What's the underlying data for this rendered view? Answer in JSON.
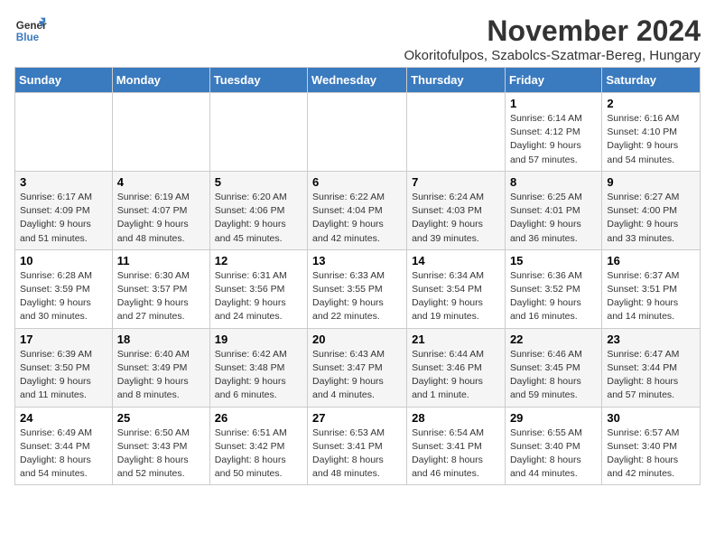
{
  "logo": {
    "line1": "General",
    "line2": "Blue"
  },
  "title": "November 2024",
  "location": "Okoritofulpos, Szabolcs-Szatmar-Bereg, Hungary",
  "days_of_week": [
    "Sunday",
    "Monday",
    "Tuesday",
    "Wednesday",
    "Thursday",
    "Friday",
    "Saturday"
  ],
  "weeks": [
    [
      {
        "day": "",
        "info": ""
      },
      {
        "day": "",
        "info": ""
      },
      {
        "day": "",
        "info": ""
      },
      {
        "day": "",
        "info": ""
      },
      {
        "day": "",
        "info": ""
      },
      {
        "day": "1",
        "info": "Sunrise: 6:14 AM\nSunset: 4:12 PM\nDaylight: 9 hours\nand 57 minutes."
      },
      {
        "day": "2",
        "info": "Sunrise: 6:16 AM\nSunset: 4:10 PM\nDaylight: 9 hours\nand 54 minutes."
      }
    ],
    [
      {
        "day": "3",
        "info": "Sunrise: 6:17 AM\nSunset: 4:09 PM\nDaylight: 9 hours\nand 51 minutes."
      },
      {
        "day": "4",
        "info": "Sunrise: 6:19 AM\nSunset: 4:07 PM\nDaylight: 9 hours\nand 48 minutes."
      },
      {
        "day": "5",
        "info": "Sunrise: 6:20 AM\nSunset: 4:06 PM\nDaylight: 9 hours\nand 45 minutes."
      },
      {
        "day": "6",
        "info": "Sunrise: 6:22 AM\nSunset: 4:04 PM\nDaylight: 9 hours\nand 42 minutes."
      },
      {
        "day": "7",
        "info": "Sunrise: 6:24 AM\nSunset: 4:03 PM\nDaylight: 9 hours\nand 39 minutes."
      },
      {
        "day": "8",
        "info": "Sunrise: 6:25 AM\nSunset: 4:01 PM\nDaylight: 9 hours\nand 36 minutes."
      },
      {
        "day": "9",
        "info": "Sunrise: 6:27 AM\nSunset: 4:00 PM\nDaylight: 9 hours\nand 33 minutes."
      }
    ],
    [
      {
        "day": "10",
        "info": "Sunrise: 6:28 AM\nSunset: 3:59 PM\nDaylight: 9 hours\nand 30 minutes."
      },
      {
        "day": "11",
        "info": "Sunrise: 6:30 AM\nSunset: 3:57 PM\nDaylight: 9 hours\nand 27 minutes."
      },
      {
        "day": "12",
        "info": "Sunrise: 6:31 AM\nSunset: 3:56 PM\nDaylight: 9 hours\nand 24 minutes."
      },
      {
        "day": "13",
        "info": "Sunrise: 6:33 AM\nSunset: 3:55 PM\nDaylight: 9 hours\nand 22 minutes."
      },
      {
        "day": "14",
        "info": "Sunrise: 6:34 AM\nSunset: 3:54 PM\nDaylight: 9 hours\nand 19 minutes."
      },
      {
        "day": "15",
        "info": "Sunrise: 6:36 AM\nSunset: 3:52 PM\nDaylight: 9 hours\nand 16 minutes."
      },
      {
        "day": "16",
        "info": "Sunrise: 6:37 AM\nSunset: 3:51 PM\nDaylight: 9 hours\nand 14 minutes."
      }
    ],
    [
      {
        "day": "17",
        "info": "Sunrise: 6:39 AM\nSunset: 3:50 PM\nDaylight: 9 hours\nand 11 minutes."
      },
      {
        "day": "18",
        "info": "Sunrise: 6:40 AM\nSunset: 3:49 PM\nDaylight: 9 hours\nand 8 minutes."
      },
      {
        "day": "19",
        "info": "Sunrise: 6:42 AM\nSunset: 3:48 PM\nDaylight: 9 hours\nand 6 minutes."
      },
      {
        "day": "20",
        "info": "Sunrise: 6:43 AM\nSunset: 3:47 PM\nDaylight: 9 hours\nand 4 minutes."
      },
      {
        "day": "21",
        "info": "Sunrise: 6:44 AM\nSunset: 3:46 PM\nDaylight: 9 hours\nand 1 minute."
      },
      {
        "day": "22",
        "info": "Sunrise: 6:46 AM\nSunset: 3:45 PM\nDaylight: 8 hours\nand 59 minutes."
      },
      {
        "day": "23",
        "info": "Sunrise: 6:47 AM\nSunset: 3:44 PM\nDaylight: 8 hours\nand 57 minutes."
      }
    ],
    [
      {
        "day": "24",
        "info": "Sunrise: 6:49 AM\nSunset: 3:44 PM\nDaylight: 8 hours\nand 54 minutes."
      },
      {
        "day": "25",
        "info": "Sunrise: 6:50 AM\nSunset: 3:43 PM\nDaylight: 8 hours\nand 52 minutes."
      },
      {
        "day": "26",
        "info": "Sunrise: 6:51 AM\nSunset: 3:42 PM\nDaylight: 8 hours\nand 50 minutes."
      },
      {
        "day": "27",
        "info": "Sunrise: 6:53 AM\nSunset: 3:41 PM\nDaylight: 8 hours\nand 48 minutes."
      },
      {
        "day": "28",
        "info": "Sunrise: 6:54 AM\nSunset: 3:41 PM\nDaylight: 8 hours\nand 46 minutes."
      },
      {
        "day": "29",
        "info": "Sunrise: 6:55 AM\nSunset: 3:40 PM\nDaylight: 8 hours\nand 44 minutes."
      },
      {
        "day": "30",
        "info": "Sunrise: 6:57 AM\nSunset: 3:40 PM\nDaylight: 8 hours\nand 42 minutes."
      }
    ]
  ]
}
